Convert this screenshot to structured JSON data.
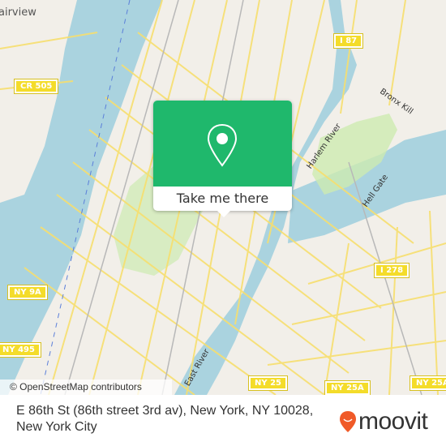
{
  "map": {
    "place_labels": [
      "airview"
    ],
    "road_shields": [
      "CR 505",
      "I 87",
      "I 278",
      "NY 9A",
      "NY 495",
      "NY 25",
      "NY 25A",
      "NY 25A"
    ],
    "water_labels": [
      "Harlem River",
      "Hell Gate",
      "Bronx Kill",
      "East River"
    ],
    "attribution": "© OpenStreetMap contributors",
    "colors": {
      "water": "#aad3df",
      "land": "#f2efe9",
      "park": "#cdebb0",
      "road": "#f7df6e"
    }
  },
  "popup": {
    "icon": "map-pin-icon",
    "button_label": "Take me there",
    "accent_color": "#1fb86c"
  },
  "footer": {
    "address": "E 86th St (86th street 3rd av), New York, NY 10028, New York City",
    "brand_name": "moovit",
    "brand_icon": "moovit-pin-icon",
    "brand_color": "#f05a28"
  }
}
